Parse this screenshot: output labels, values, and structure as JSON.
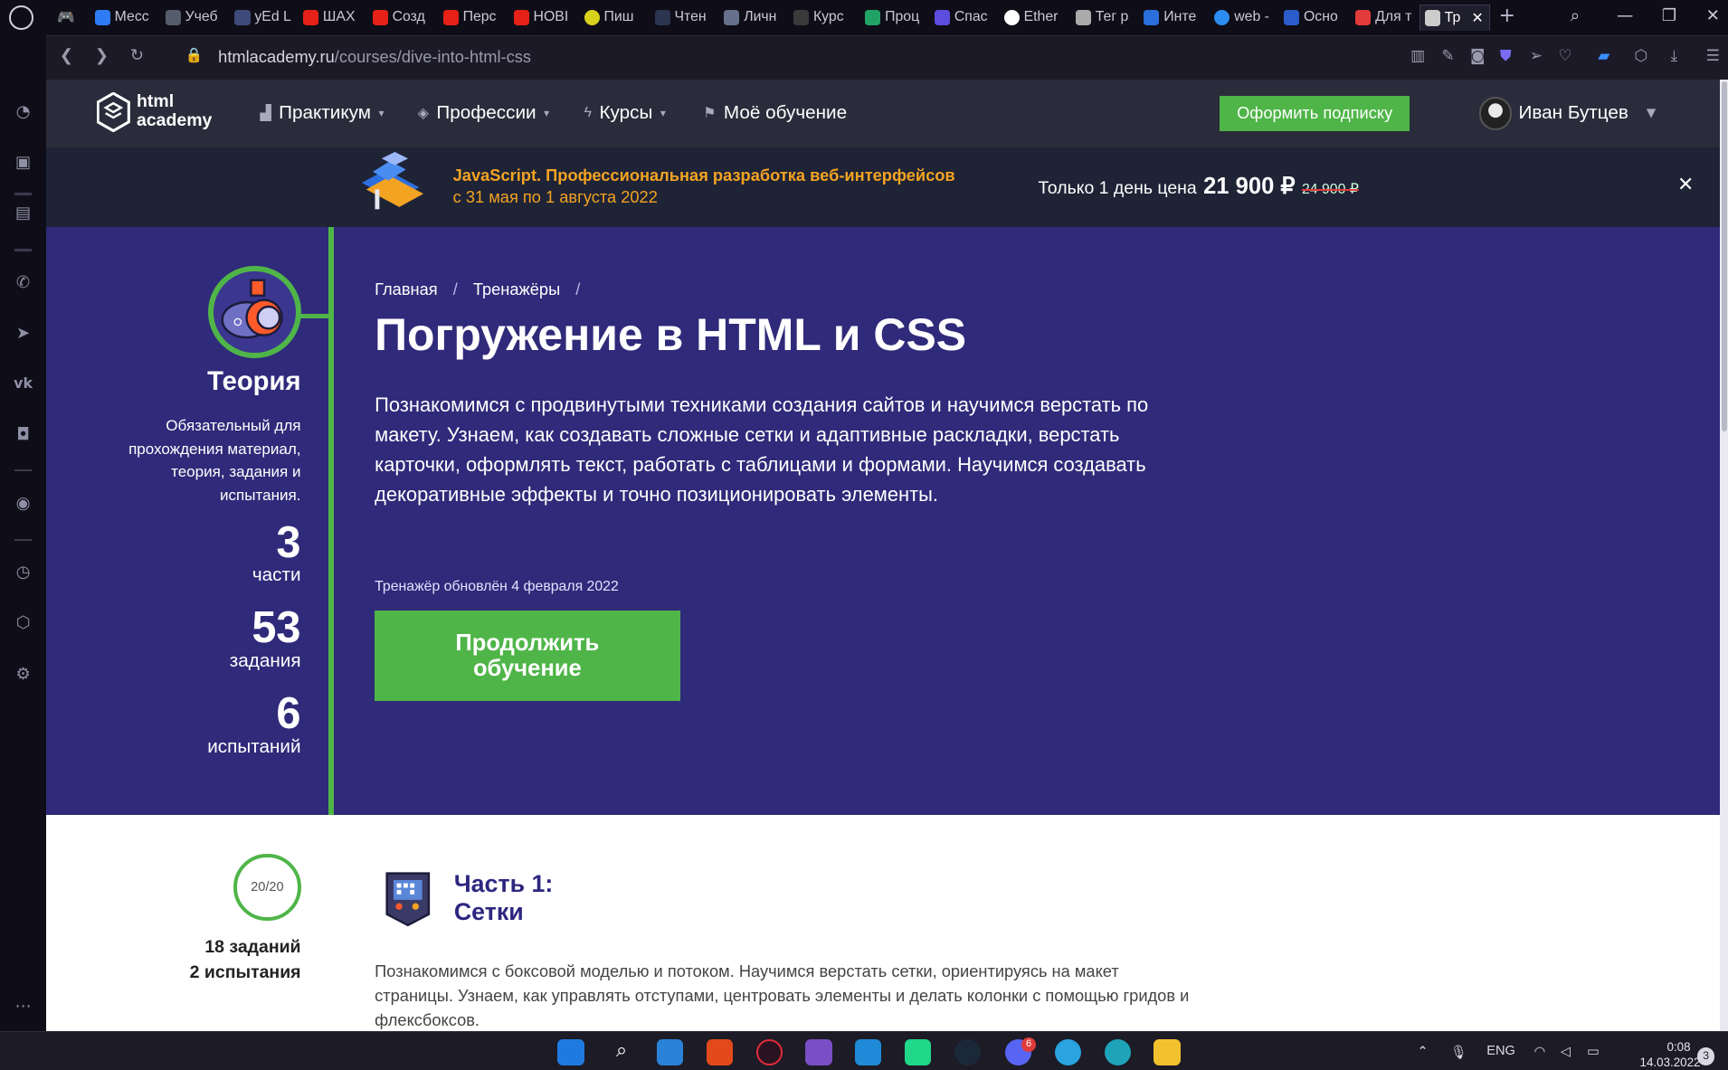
{
  "browser": {
    "tabs": [
      {
        "label": "Месс",
        "color": "#2d7cf6"
      },
      {
        "label": "Учеб",
        "color": "#555c6b"
      },
      {
        "label": "yEd L",
        "color": "#3d4a7a"
      },
      {
        "label": "ШАХ",
        "color": "#e62117"
      },
      {
        "label": "Созд",
        "color": "#e62117"
      },
      {
        "label": "Перс",
        "color": "#e62117"
      },
      {
        "label": "НОВІ",
        "color": "#e62117"
      },
      {
        "label": "Пиш",
        "color": "#d8d21c"
      },
      {
        "label": "Чтен",
        "color": "#2b3550"
      },
      {
        "label": "Личн",
        "color": "#66708a"
      },
      {
        "label": "Курс",
        "color": "#3a3a3a"
      },
      {
        "label": "Проц",
        "color": "#22a366"
      },
      {
        "label": "Спас",
        "color": "#5c4ddf"
      },
      {
        "label": "Ether",
        "color": "#ffffff"
      },
      {
        "label": "Тег р",
        "color": "#aaaaaa"
      },
      {
        "label": "Инте",
        "color": "#2a6fdb"
      },
      {
        "label": "web -",
        "color": "#2d8cf0"
      },
      {
        "label": "Осно",
        "color": "#2b5ccc"
      },
      {
        "label": "Для т",
        "color": "#e23b3b"
      },
      {
        "label": "Тр",
        "color": "#cccccc"
      }
    ],
    "url_host": "htmlacademy.ru",
    "url_path": "/courses/dive-into-html-css"
  },
  "site": {
    "logo_line1": "html",
    "logo_line2": "academy",
    "nav": [
      {
        "label": "Практикум",
        "icon": "chart-icon",
        "caret": "▾"
      },
      {
        "label": "Профессии",
        "icon": "graduation-cap-icon",
        "caret": "▾"
      },
      {
        "label": "Курсы",
        "icon": "lightning-icon",
        "caret": "▾"
      },
      {
        "label": "Моё обучение",
        "icon": "people-icon",
        "caret": ""
      }
    ],
    "subscribe_label": "Оформить подписку",
    "user_name": "Иван Бутцев"
  },
  "promo": {
    "title": "JavaScript. Профессиональная разработка веб-интерфейсов",
    "dates": "с 31 мая по 1 августа 2022",
    "offer_text": "Только 1 день цена",
    "price": "21 900 ₽",
    "old_price": "24 900 ₽",
    "close": "✕"
  },
  "sidebar_left": {
    "title": "Теория",
    "description": "Обязательный для прохождения материал, теория, задания и испытания.",
    "stats": [
      {
        "value": "3",
        "label": "части"
      },
      {
        "value": "53",
        "label": "задания"
      },
      {
        "value": "6",
        "label": "испытаний"
      }
    ]
  },
  "hero": {
    "breadcrumbs": [
      "Главная",
      "Тренажёры"
    ],
    "title": "Погружение в HTML и CSS",
    "description": "Познакомимся с продвинутыми техниками создания сайтов и научимся верстать по макету. Узнаем, как создавать сложные сетки и адаптивные раскладки, верстать карточки, оформлять текст, работать с таблицами и формами. Научимся создавать декоративные эффекты и точно позиционировать элементы.",
    "updated": "Тренажёр обновлён 4 февраля 2022",
    "continue_label": "Продолжить обучение"
  },
  "part1": {
    "progress": "20/20",
    "tasks": "18 заданий",
    "tests": "2 испытания",
    "title_line1": "Часть 1:",
    "title_line2": "Сетки",
    "description": "Познакомимся с боксовой моделью и потоком. Научимся верстать сетки, ориентируясь на макет страницы. Узнаем, как управлять отступами, центровать элементы и делать колонки с помощью гридов и флексбоксов."
  },
  "taskbar": {
    "language": "ENG",
    "time": "0:08",
    "date": "14.03.2022",
    "notifications": "3",
    "discord_badge": "6"
  },
  "colors": {
    "hero_bg": "#302a7a",
    "accent_green": "#4fb548",
    "promo_orange": "#f3a322",
    "header_bg": "#2b2c3b"
  }
}
